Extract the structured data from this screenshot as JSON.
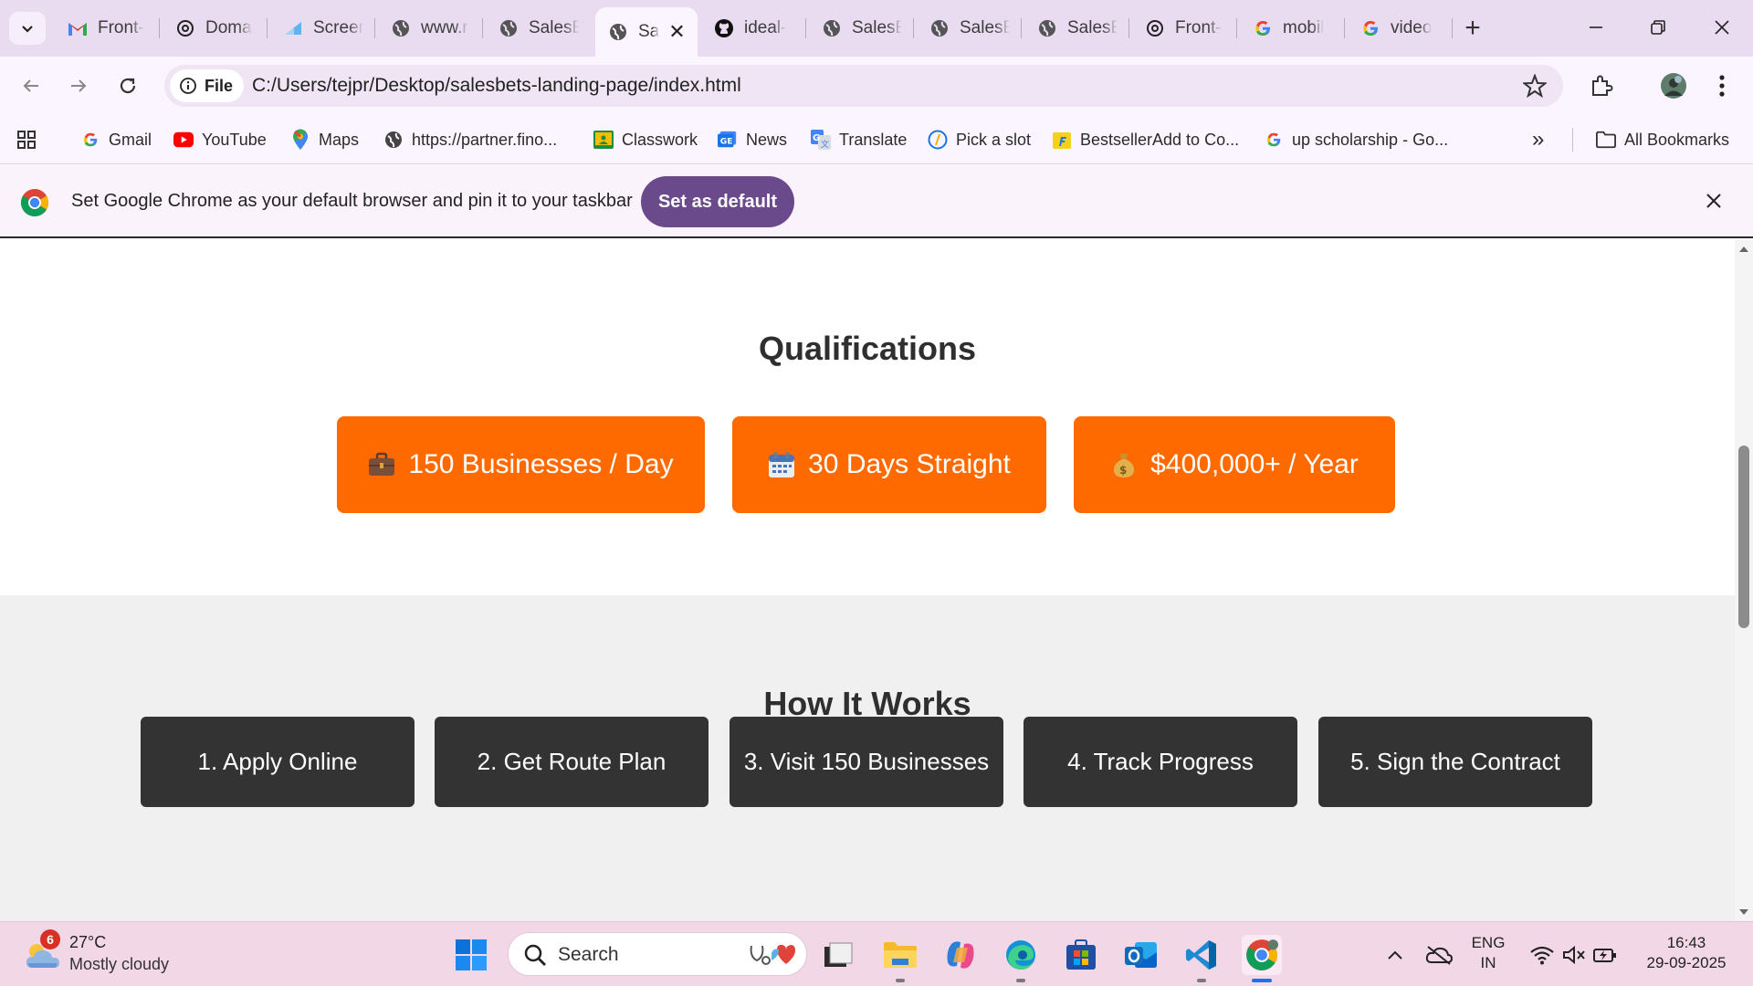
{
  "browser": {
    "tabs": [
      {
        "title": "Front-",
        "icon": "gmail-icon",
        "active": false
      },
      {
        "title": "Doma",
        "icon": "openai-icon",
        "active": false
      },
      {
        "title": "Screer",
        "icon": "screen-icon",
        "active": false
      },
      {
        "title": "www.r",
        "icon": "globe-icon",
        "active": false
      },
      {
        "title": "SalesE",
        "icon": "globe-icon",
        "active": false
      },
      {
        "title": "Sa",
        "icon": "globe-icon",
        "active": true
      },
      {
        "title": "ideal-",
        "icon": "github-icon",
        "active": false
      },
      {
        "title": "SalesE",
        "icon": "globe-icon",
        "active": false
      },
      {
        "title": "SalesE",
        "icon": "globe-icon",
        "active": false
      },
      {
        "title": "SalesE",
        "icon": "globe-icon",
        "active": false
      },
      {
        "title": "Front-",
        "icon": "openai-icon",
        "active": false
      },
      {
        "title": "mobil",
        "icon": "google-icon",
        "active": false
      },
      {
        "title": "video",
        "icon": "google-icon",
        "active": false
      }
    ],
    "close_tab_glyph": "✕",
    "new_tab_glyph": "+",
    "address": {
      "chip_label": "File",
      "url": "C:/Users/tejpr/Desktop/salesbets-landing-page/index.html"
    },
    "bookmarks": [
      {
        "label": "Gmail",
        "icon": "google-icon"
      },
      {
        "label": "YouTube",
        "icon": "youtube-icon"
      },
      {
        "label": "Maps",
        "icon": "maps-pin-icon"
      },
      {
        "label": "https://partner.fino...",
        "icon": "globe-icon"
      },
      {
        "label": "Classwork",
        "icon": "classroom-icon"
      },
      {
        "label": "News",
        "icon": "news-icon"
      },
      {
        "label": "Translate",
        "icon": "translate-icon"
      },
      {
        "label": "Pick a slot",
        "icon": "slot-icon"
      },
      {
        "label": "BestsellerAdd to Co...",
        "icon": "flipkart-icon"
      },
      {
        "label": "up scholarship - Go...",
        "icon": "google-icon"
      }
    ],
    "bookmarks_overflow": "»",
    "all_bookmarks_label": "All Bookmarks",
    "infobar": {
      "message": "Set Google Chrome as your default browser and pin it to your taskbar",
      "button_label": "Set as default"
    }
  },
  "page": {
    "qualifications": {
      "title": "Qualifications",
      "cards": [
        {
          "emoji": "briefcase-icon",
          "glyph": "💼",
          "label": "150 Businesses / Day"
        },
        {
          "emoji": "calendar-icon",
          "glyph": "📅",
          "label": "30 Days Straight"
        },
        {
          "emoji": "money-bag-icon",
          "glyph": "💰",
          "label": "$400,000+ / Year"
        }
      ]
    },
    "how_it_works": {
      "title": "How It Works",
      "steps": [
        "1. Apply Online",
        "2. Get Route Plan",
        "3. Visit 150 Businesses",
        "4. Track Progress",
        "5. Sign the Contract"
      ]
    }
  },
  "taskbar": {
    "weather": {
      "badge": "6",
      "temp": "27°C",
      "condition": "Mostly cloudy"
    },
    "search_label": "Search",
    "language": {
      "line1": "ENG",
      "line2": "IN"
    },
    "clock": {
      "time": "16:43",
      "date": "29-09-2025"
    }
  },
  "colors": {
    "accent_orange": "#ff6a00",
    "step_dark": "#333333",
    "infobar_button": "#6b4a8c",
    "tabstrip": "#e9dcf0"
  }
}
